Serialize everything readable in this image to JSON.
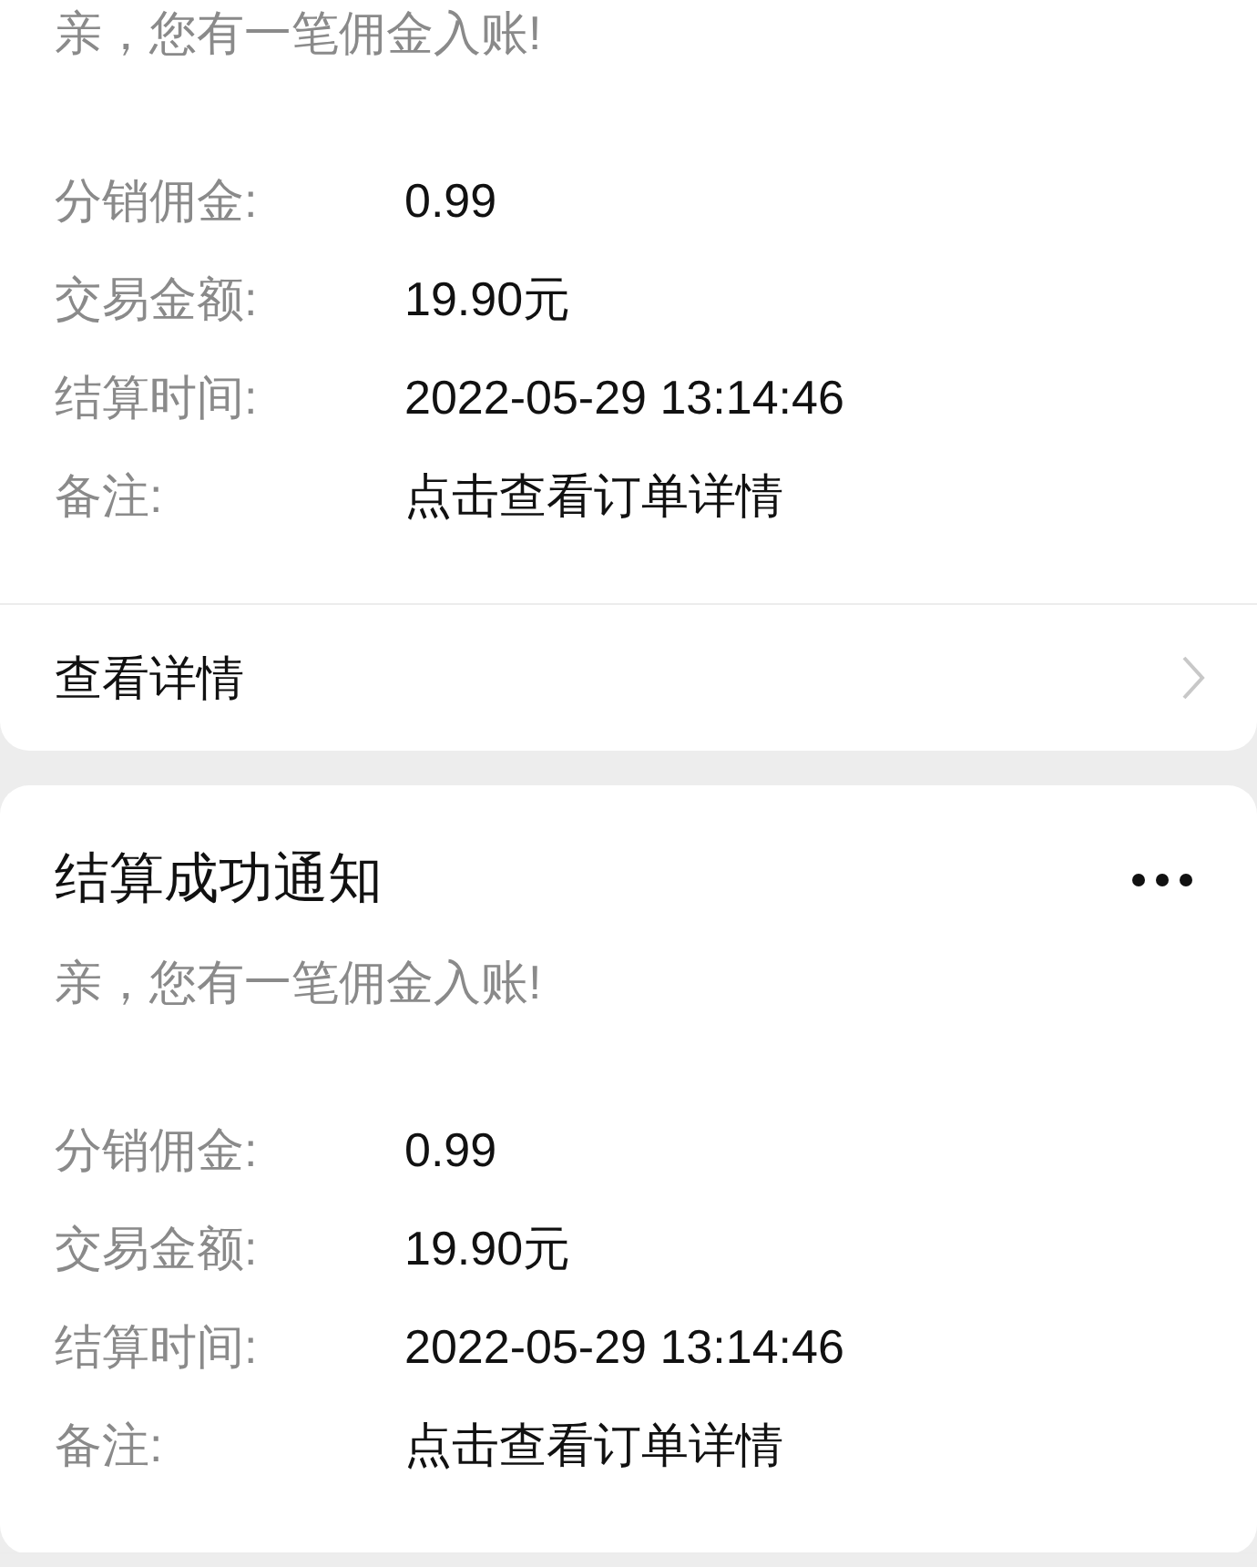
{
  "cards": [
    {
      "subtitle": "亲，您有一笔佣金入账!",
      "fields": [
        {
          "label": "分销佣金:",
          "value": "0.99"
        },
        {
          "label": "交易金额:",
          "value": "19.90元"
        },
        {
          "label": "结算时间:",
          "value": "2022-05-29 13:14:46"
        },
        {
          "label": "备注:",
          "value": "点击查看订单详情"
        }
      ],
      "footer": "查看详情"
    },
    {
      "title": "结算成功通知",
      "subtitle": "亲，您有一笔佣金入账!",
      "fields": [
        {
          "label": "分销佣金:",
          "value": "0.99"
        },
        {
          "label": "交易金额:",
          "value": "19.90元"
        },
        {
          "label": "结算时间:",
          "value": "2022-05-29 13:14:46"
        },
        {
          "label": "备注:",
          "value": "点击查看订单详情"
        }
      ]
    }
  ]
}
